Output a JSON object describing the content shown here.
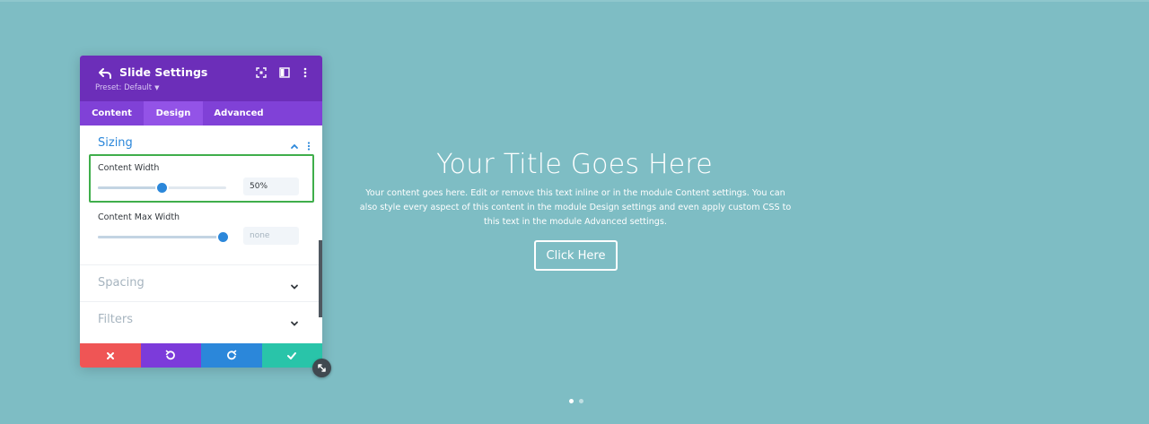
{
  "slide": {
    "title": "Your Title Goes Here",
    "body": "Your content goes here. Edit or remove this text inline or in the module Content settings. You can also style every aspect of this content in the module Design settings and even apply custom CSS to this text in the module Advanced settings.",
    "button_label": "Click Here",
    "active_dot": 1,
    "dot_count": 2
  },
  "panel": {
    "title": "Slide Settings",
    "preset_label": "Preset: Default",
    "tabs": [
      {
        "label": "Content",
        "active": false
      },
      {
        "label": "Design",
        "active": true
      },
      {
        "label": "Advanced",
        "active": false
      }
    ],
    "sections": {
      "sizing": {
        "title": "Sizing",
        "fields": {
          "content_width": {
            "label": "Content Width",
            "value": "50%",
            "level": 0.5
          },
          "content_max_width": {
            "label": "Content Max Width",
            "placeholder": "none",
            "level": 1.0
          }
        }
      },
      "spacing": {
        "title": "Spacing"
      },
      "filters": {
        "title": "Filters"
      }
    },
    "footer_icons": [
      "close-icon",
      "undo-icon",
      "redo-icon",
      "check-icon"
    ]
  },
  "colors": {
    "background": "#7ebdc4",
    "header": "#6c2eb9",
    "tabs": "#8041d7",
    "tab_active": "#9353e7",
    "accent": "#2b87da",
    "highlight": "#3fae4b",
    "footer_close": "#ef5555",
    "footer_undo": "#7c3bda",
    "footer_redo": "#2b87da",
    "footer_save": "#29c4a9"
  }
}
